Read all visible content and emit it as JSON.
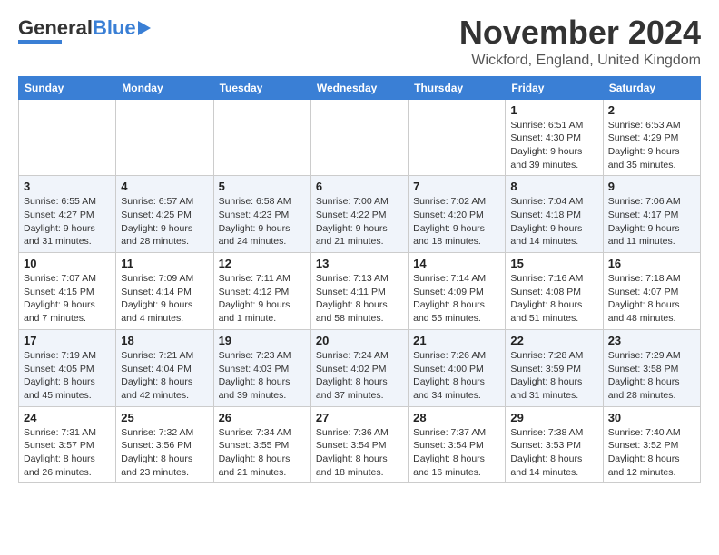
{
  "logo": {
    "text_general": "General",
    "text_blue": "Blue"
  },
  "header": {
    "month_title": "November 2024",
    "location": "Wickford, England, United Kingdom"
  },
  "weekdays": [
    "Sunday",
    "Monday",
    "Tuesday",
    "Wednesday",
    "Thursday",
    "Friday",
    "Saturday"
  ],
  "weeks": [
    [
      {
        "day": "",
        "info": ""
      },
      {
        "day": "",
        "info": ""
      },
      {
        "day": "",
        "info": ""
      },
      {
        "day": "",
        "info": ""
      },
      {
        "day": "",
        "info": ""
      },
      {
        "day": "1",
        "info": "Sunrise: 6:51 AM\nSunset: 4:30 PM\nDaylight: 9 hours and 39 minutes."
      },
      {
        "day": "2",
        "info": "Sunrise: 6:53 AM\nSunset: 4:29 PM\nDaylight: 9 hours and 35 minutes."
      }
    ],
    [
      {
        "day": "3",
        "info": "Sunrise: 6:55 AM\nSunset: 4:27 PM\nDaylight: 9 hours and 31 minutes."
      },
      {
        "day": "4",
        "info": "Sunrise: 6:57 AM\nSunset: 4:25 PM\nDaylight: 9 hours and 28 minutes."
      },
      {
        "day": "5",
        "info": "Sunrise: 6:58 AM\nSunset: 4:23 PM\nDaylight: 9 hours and 24 minutes."
      },
      {
        "day": "6",
        "info": "Sunrise: 7:00 AM\nSunset: 4:22 PM\nDaylight: 9 hours and 21 minutes."
      },
      {
        "day": "7",
        "info": "Sunrise: 7:02 AM\nSunset: 4:20 PM\nDaylight: 9 hours and 18 minutes."
      },
      {
        "day": "8",
        "info": "Sunrise: 7:04 AM\nSunset: 4:18 PM\nDaylight: 9 hours and 14 minutes."
      },
      {
        "day": "9",
        "info": "Sunrise: 7:06 AM\nSunset: 4:17 PM\nDaylight: 9 hours and 11 minutes."
      }
    ],
    [
      {
        "day": "10",
        "info": "Sunrise: 7:07 AM\nSunset: 4:15 PM\nDaylight: 9 hours and 7 minutes."
      },
      {
        "day": "11",
        "info": "Sunrise: 7:09 AM\nSunset: 4:14 PM\nDaylight: 9 hours and 4 minutes."
      },
      {
        "day": "12",
        "info": "Sunrise: 7:11 AM\nSunset: 4:12 PM\nDaylight: 9 hours and 1 minute."
      },
      {
        "day": "13",
        "info": "Sunrise: 7:13 AM\nSunset: 4:11 PM\nDaylight: 8 hours and 58 minutes."
      },
      {
        "day": "14",
        "info": "Sunrise: 7:14 AM\nSunset: 4:09 PM\nDaylight: 8 hours and 55 minutes."
      },
      {
        "day": "15",
        "info": "Sunrise: 7:16 AM\nSunset: 4:08 PM\nDaylight: 8 hours and 51 minutes."
      },
      {
        "day": "16",
        "info": "Sunrise: 7:18 AM\nSunset: 4:07 PM\nDaylight: 8 hours and 48 minutes."
      }
    ],
    [
      {
        "day": "17",
        "info": "Sunrise: 7:19 AM\nSunset: 4:05 PM\nDaylight: 8 hours and 45 minutes."
      },
      {
        "day": "18",
        "info": "Sunrise: 7:21 AM\nSunset: 4:04 PM\nDaylight: 8 hours and 42 minutes."
      },
      {
        "day": "19",
        "info": "Sunrise: 7:23 AM\nSunset: 4:03 PM\nDaylight: 8 hours and 39 minutes."
      },
      {
        "day": "20",
        "info": "Sunrise: 7:24 AM\nSunset: 4:02 PM\nDaylight: 8 hours and 37 minutes."
      },
      {
        "day": "21",
        "info": "Sunrise: 7:26 AM\nSunset: 4:00 PM\nDaylight: 8 hours and 34 minutes."
      },
      {
        "day": "22",
        "info": "Sunrise: 7:28 AM\nSunset: 3:59 PM\nDaylight: 8 hours and 31 minutes."
      },
      {
        "day": "23",
        "info": "Sunrise: 7:29 AM\nSunset: 3:58 PM\nDaylight: 8 hours and 28 minutes."
      }
    ],
    [
      {
        "day": "24",
        "info": "Sunrise: 7:31 AM\nSunset: 3:57 PM\nDaylight: 8 hours and 26 minutes."
      },
      {
        "day": "25",
        "info": "Sunrise: 7:32 AM\nSunset: 3:56 PM\nDaylight: 8 hours and 23 minutes."
      },
      {
        "day": "26",
        "info": "Sunrise: 7:34 AM\nSunset: 3:55 PM\nDaylight: 8 hours and 21 minutes."
      },
      {
        "day": "27",
        "info": "Sunrise: 7:36 AM\nSunset: 3:54 PM\nDaylight: 8 hours and 18 minutes."
      },
      {
        "day": "28",
        "info": "Sunrise: 7:37 AM\nSunset: 3:54 PM\nDaylight: 8 hours and 16 minutes."
      },
      {
        "day": "29",
        "info": "Sunrise: 7:38 AM\nSunset: 3:53 PM\nDaylight: 8 hours and 14 minutes."
      },
      {
        "day": "30",
        "info": "Sunrise: 7:40 AM\nSunset: 3:52 PM\nDaylight: 8 hours and 12 minutes."
      }
    ]
  ]
}
